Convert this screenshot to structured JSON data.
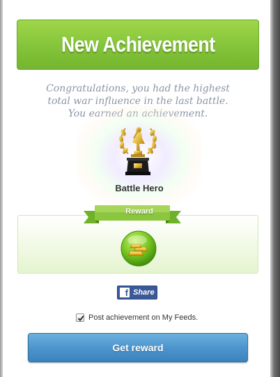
{
  "dialog": {
    "title": "New Achievement",
    "message_lines": [
      "Congratulations, you had the highest",
      "total war influence in the last battle.",
      "You earned an achievement."
    ],
    "achievement": {
      "name": "Battle Hero",
      "icon": "trophy-icon"
    },
    "reward": {
      "ribbon_label": "Reward",
      "icon": "gold-bars-icon"
    },
    "share": {
      "icon": "facebook-icon",
      "label": "Share"
    },
    "post_feed": {
      "checked": true,
      "label": "Post achievement on My Feeds."
    },
    "primary_button_label": "Get reward"
  },
  "colors": {
    "title_green": "#84c43a",
    "button_blue": "#4d95cc",
    "facebook_blue": "#3b5998",
    "message_gray": "#8a95a6"
  }
}
